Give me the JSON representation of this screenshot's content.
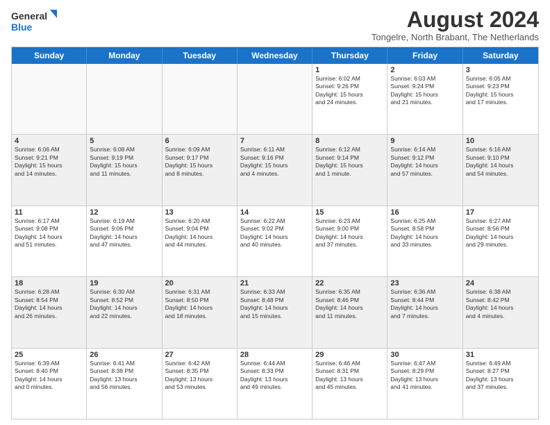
{
  "logo": {
    "line1": "General",
    "line2": "Blue"
  },
  "title": "August 2024",
  "subtitle": "Tongelre, North Brabant, The Netherlands",
  "days": [
    "Sunday",
    "Monday",
    "Tuesday",
    "Wednesday",
    "Thursday",
    "Friday",
    "Saturday"
  ],
  "rows": [
    [
      {
        "day": "",
        "text": ""
      },
      {
        "day": "",
        "text": ""
      },
      {
        "day": "",
        "text": ""
      },
      {
        "day": "",
        "text": ""
      },
      {
        "day": "1",
        "text": "Sunrise: 6:02 AM\nSunset: 9:26 PM\nDaylight: 15 hours\nand 24 minutes."
      },
      {
        "day": "2",
        "text": "Sunrise: 6:03 AM\nSunset: 9:24 PM\nDaylight: 15 hours\nand 21 minutes."
      },
      {
        "day": "3",
        "text": "Sunrise: 6:05 AM\nSunset: 9:23 PM\nDaylight: 15 hours\nand 17 minutes."
      }
    ],
    [
      {
        "day": "4",
        "text": "Sunrise: 6:06 AM\nSunset: 9:21 PM\nDaylight: 15 hours\nand 14 minutes."
      },
      {
        "day": "5",
        "text": "Sunrise: 6:08 AM\nSunset: 9:19 PM\nDaylight: 15 hours\nand 11 minutes."
      },
      {
        "day": "6",
        "text": "Sunrise: 6:09 AM\nSunset: 9:17 PM\nDaylight: 15 hours\nand 8 minutes."
      },
      {
        "day": "7",
        "text": "Sunrise: 6:11 AM\nSunset: 9:16 PM\nDaylight: 15 hours\nand 4 minutes."
      },
      {
        "day": "8",
        "text": "Sunrise: 6:12 AM\nSunset: 9:14 PM\nDaylight: 15 hours\nand 1 minute."
      },
      {
        "day": "9",
        "text": "Sunrise: 6:14 AM\nSunset: 9:12 PM\nDaylight: 14 hours\nand 57 minutes."
      },
      {
        "day": "10",
        "text": "Sunrise: 6:16 AM\nSunset: 9:10 PM\nDaylight: 14 hours\nand 54 minutes."
      }
    ],
    [
      {
        "day": "11",
        "text": "Sunrise: 6:17 AM\nSunset: 9:08 PM\nDaylight: 14 hours\nand 51 minutes."
      },
      {
        "day": "12",
        "text": "Sunrise: 6:19 AM\nSunset: 9:06 PM\nDaylight: 14 hours\nand 47 minutes."
      },
      {
        "day": "13",
        "text": "Sunrise: 6:20 AM\nSunset: 9:04 PM\nDaylight: 14 hours\nand 44 minutes."
      },
      {
        "day": "14",
        "text": "Sunrise: 6:22 AM\nSunset: 9:02 PM\nDaylight: 14 hours\nand 40 minutes."
      },
      {
        "day": "15",
        "text": "Sunrise: 6:23 AM\nSunset: 9:00 PM\nDaylight: 14 hours\nand 37 minutes."
      },
      {
        "day": "16",
        "text": "Sunrise: 6:25 AM\nSunset: 8:58 PM\nDaylight: 14 hours\nand 33 minutes."
      },
      {
        "day": "17",
        "text": "Sunrise: 6:27 AM\nSunset: 8:56 PM\nDaylight: 14 hours\nand 29 minutes."
      }
    ],
    [
      {
        "day": "18",
        "text": "Sunrise: 6:28 AM\nSunset: 8:54 PM\nDaylight: 14 hours\nand 26 minutes."
      },
      {
        "day": "19",
        "text": "Sunrise: 6:30 AM\nSunset: 8:52 PM\nDaylight: 14 hours\nand 22 minutes."
      },
      {
        "day": "20",
        "text": "Sunrise: 6:31 AM\nSunset: 8:50 PM\nDaylight: 14 hours\nand 18 minutes."
      },
      {
        "day": "21",
        "text": "Sunrise: 6:33 AM\nSunset: 8:48 PM\nDaylight: 14 hours\nand 15 minutes."
      },
      {
        "day": "22",
        "text": "Sunrise: 6:35 AM\nSunset: 8:46 PM\nDaylight: 14 hours\nand 11 minutes."
      },
      {
        "day": "23",
        "text": "Sunrise: 6:36 AM\nSunset: 8:44 PM\nDaylight: 14 hours\nand 7 minutes."
      },
      {
        "day": "24",
        "text": "Sunrise: 6:38 AM\nSunset: 8:42 PM\nDaylight: 14 hours\nand 4 minutes."
      }
    ],
    [
      {
        "day": "25",
        "text": "Sunrise: 6:39 AM\nSunset: 8:40 PM\nDaylight: 14 hours\nand 0 minutes."
      },
      {
        "day": "26",
        "text": "Sunrise: 6:41 AM\nSunset: 8:38 PM\nDaylight: 13 hours\nand 56 minutes."
      },
      {
        "day": "27",
        "text": "Sunrise: 6:42 AM\nSunset: 8:35 PM\nDaylight: 13 hours\nand 53 minutes."
      },
      {
        "day": "28",
        "text": "Sunrise: 6:44 AM\nSunset: 8:33 PM\nDaylight: 13 hours\nand 49 minutes."
      },
      {
        "day": "29",
        "text": "Sunrise: 6:46 AM\nSunset: 8:31 PM\nDaylight: 13 hours\nand 45 minutes."
      },
      {
        "day": "30",
        "text": "Sunrise: 6:47 AM\nSunset: 8:29 PM\nDaylight: 13 hours\nand 41 minutes."
      },
      {
        "day": "31",
        "text": "Sunrise: 6:49 AM\nSunset: 8:27 PM\nDaylight: 13 hours\nand 37 minutes."
      }
    ]
  ]
}
